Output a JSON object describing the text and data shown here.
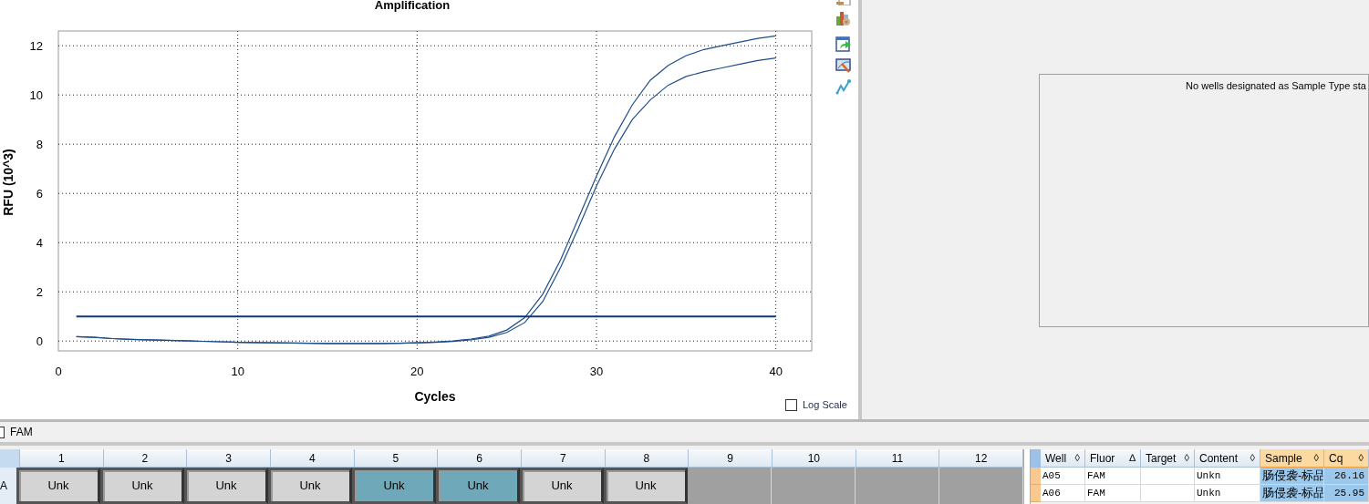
{
  "chart": {
    "chart_data": {
      "type": "line",
      "title": "Amplification",
      "xlabel": "Cycles",
      "ylabel": "RFU (10^3)",
      "x": [
        1,
        2,
        3,
        4,
        5,
        6,
        7,
        8,
        9,
        10,
        11,
        12,
        13,
        14,
        15,
        16,
        17,
        18,
        19,
        20,
        21,
        22,
        23,
        24,
        25,
        26,
        27,
        28,
        29,
        30,
        31,
        32,
        33,
        34,
        35,
        36,
        37,
        38,
        39,
        40
      ],
      "series": [
        {
          "color": "#1f4e8c",
          "values": [
            0.18,
            0.15,
            0.1,
            0.07,
            0.05,
            0.03,
            0.01,
            -0.01,
            -0.03,
            -0.05,
            -0.06,
            -0.07,
            -0.08,
            -0.09,
            -0.1,
            -0.1,
            -0.1,
            -0.1,
            -0.09,
            -0.07,
            -0.04,
            0.0,
            0.08,
            0.2,
            0.45,
            0.95,
            1.9,
            3.3,
            5.0,
            6.7,
            8.3,
            9.6,
            10.6,
            11.2,
            11.6,
            11.85,
            12.0,
            12.15,
            12.3,
            12.4
          ]
        },
        {
          "color": "#1f4e8c",
          "values": [
            0.18,
            0.15,
            0.1,
            0.07,
            0.05,
            0.03,
            0.01,
            -0.01,
            -0.03,
            -0.05,
            -0.06,
            -0.07,
            -0.08,
            -0.09,
            -0.1,
            -0.1,
            -0.1,
            -0.1,
            -0.09,
            -0.07,
            -0.05,
            -0.02,
            0.05,
            0.15,
            0.35,
            0.75,
            1.6,
            3.0,
            4.6,
            6.3,
            7.8,
            9.0,
            9.8,
            10.4,
            10.75,
            10.95,
            11.1,
            11.25,
            11.4,
            11.5
          ]
        },
        {
          "color": "#0d3a75",
          "values": [
            1,
            1,
            1,
            1,
            1,
            1,
            1,
            1,
            1,
            1,
            1,
            1,
            1,
            1,
            1,
            1,
            1,
            1,
            1,
            1,
            1,
            1,
            1,
            1,
            1,
            1,
            1,
            1,
            1,
            1,
            1,
            1,
            1,
            1,
            1,
            1,
            1,
            1,
            1,
            1
          ]
        }
      ],
      "xlim": [
        0,
        42
      ],
      "ylim": [
        -0.4,
        12.6
      ],
      "xticks": [
        0,
        10,
        20,
        30,
        40
      ],
      "yticks": [
        0,
        2,
        4,
        6,
        8,
        10,
        12
      ],
      "grid": true
    },
    "log_scale": {
      "label": "Log Scale",
      "checked": false
    }
  },
  "standard_curve": {
    "message": "No wells designated as Sample Type sta"
  },
  "fluor_filter": {
    "label": "FAM",
    "checked": false
  },
  "plate": {
    "columns": [
      "1",
      "2",
      "3",
      "4",
      "5",
      "6",
      "7",
      "8",
      "9",
      "10",
      "11",
      "12"
    ],
    "rows": [
      {
        "label": "A",
        "wells": [
          {
            "kind": "sample",
            "text": "Unk",
            "selected": false
          },
          {
            "kind": "sample",
            "text": "Unk",
            "selected": false
          },
          {
            "kind": "sample",
            "text": "Unk",
            "selected": false
          },
          {
            "kind": "sample",
            "text": "Unk",
            "selected": false
          },
          {
            "kind": "sample",
            "text": "Unk",
            "selected": true
          },
          {
            "kind": "sample",
            "text": "Unk",
            "selected": true
          },
          {
            "kind": "sample",
            "text": "Unk",
            "selected": false
          },
          {
            "kind": "sample",
            "text": "Unk",
            "selected": false
          },
          {
            "kind": "empty"
          },
          {
            "kind": "empty"
          },
          {
            "kind": "empty"
          },
          {
            "kind": "empty"
          }
        ]
      }
    ]
  },
  "results": {
    "columns": [
      {
        "label": "Well",
        "sort": "◊",
        "highlighted": false
      },
      {
        "label": "Fluor",
        "sort": "∆",
        "highlighted": false
      },
      {
        "label": "Target",
        "sort": "◊",
        "highlighted": false
      },
      {
        "label": "Content",
        "sort": "◊",
        "highlighted": false
      },
      {
        "label": "Sample",
        "sort": "◊",
        "highlighted": true
      },
      {
        "label": "Cq",
        "sort": "◊",
        "highlighted": true
      }
    ],
    "rows": [
      {
        "cells": [
          "A05",
          "FAM",
          "",
          "Unkn",
          "肠侵袭-标品",
          "26.16"
        ]
      },
      {
        "cells": [
          "A06",
          "FAM",
          "",
          "Unkn",
          "肠侵袭-标品",
          "25.95"
        ]
      }
    ]
  }
}
